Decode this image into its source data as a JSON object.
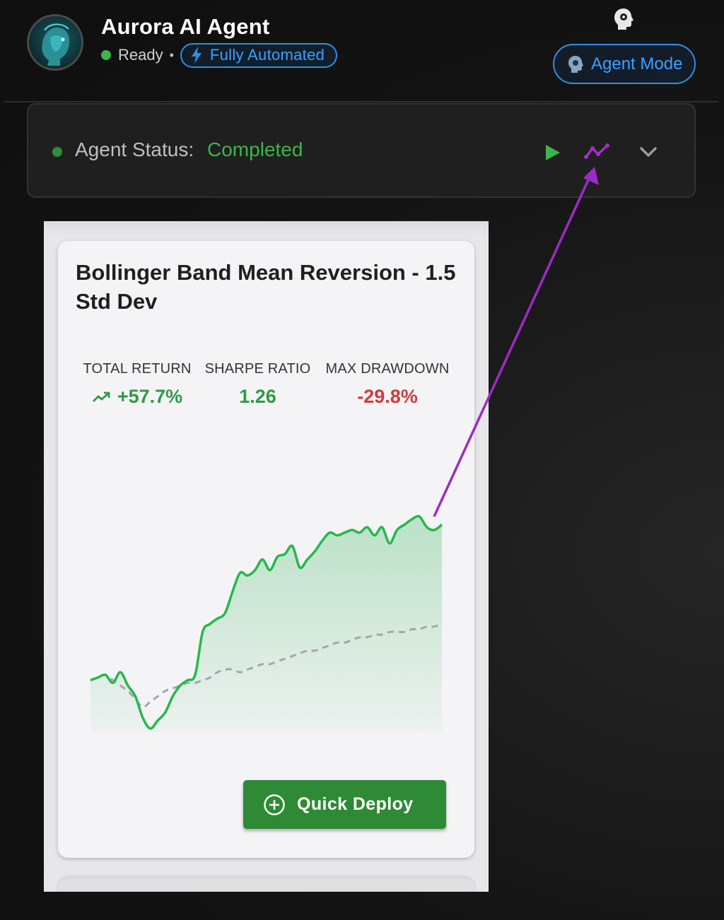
{
  "header": {
    "title": "Aurora AI Agent",
    "status_text": "Ready",
    "separator": "•",
    "automation_badge": "Fully Automated",
    "agent_mode_button": "Agent Mode"
  },
  "agent_status": {
    "label": "Agent Status:",
    "value": "Completed"
  },
  "strategy_card": {
    "title": "Bollinger Band Mean Reversion - 1.5 Std Dev",
    "metrics": [
      {
        "label": "TOTAL RETURN",
        "value": "+57.7%"
      },
      {
        "label": "SHARPE RATIO",
        "value": "1.26"
      },
      {
        "label": "MAX DRAWDOWN",
        "value": "-29.8%"
      }
    ],
    "deploy_button": "Quick Deploy"
  },
  "colors": {
    "positive": "#2e9a45",
    "negative": "#d03a3a",
    "accent_blue": "#3aa0ff",
    "annotation": "#9b2bc4"
  },
  "chart_data": {
    "type": "area",
    "title": "",
    "xlabel": "",
    "ylabel": "",
    "series": [
      {
        "values": [
          100,
          101,
          102,
          99,
          103,
          98,
          94,
          86,
          82,
          85,
          88,
          94,
          98,
          100,
          102,
          118,
          121,
          123,
          125,
          133,
          140,
          139,
          141,
          145,
          141,
          146,
          147,
          150,
          142,
          145,
          148,
          152,
          155,
          154,
          155,
          156,
          155,
          157,
          154,
          157,
          151,
          156,
          158,
          160,
          161,
          157,
          156,
          158
        ]
      },
      {
        "values": [
          100,
          101,
          102,
          100,
          98,
          96,
          93,
          90,
          92,
          94,
          96,
          97,
          98,
          99,
          99,
          100,
          101,
          103,
          104,
          104,
          103,
          104,
          105,
          106,
          106,
          107,
          108,
          109,
          110,
          111,
          111,
          112,
          113,
          114,
          114,
          115,
          116,
          116,
          117,
          117,
          118,
          118,
          118,
          119,
          119,
          120,
          120,
          121
        ]
      }
    ]
  }
}
